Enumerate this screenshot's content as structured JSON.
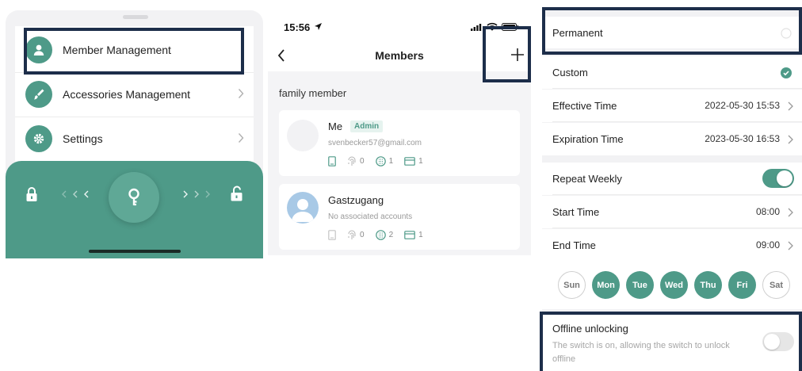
{
  "panel1": {
    "menu": [
      {
        "label": "Member Management",
        "icon": "person-icon"
      },
      {
        "label": "Accessories Management",
        "icon": "brush-icon"
      },
      {
        "label": "Settings",
        "icon": "gear-icon"
      }
    ],
    "controls": {
      "lock_icon": "lock-icon",
      "unlock_icon": "unlock-icon",
      "key_icon": "key-icon"
    },
    "colors": {
      "accent": "#4e9a88",
      "highlight": "#1d2e4a"
    }
  },
  "panel2": {
    "status_time": "15:56",
    "nav_title": "Members",
    "section": "family member",
    "members": [
      {
        "name": "Me",
        "badge": "Admin",
        "subtitle": "svenbecker57@gmail.com",
        "fingerprints": "0",
        "passwords": "1",
        "cards": "1"
      },
      {
        "name": "Gastzugang",
        "badge": "",
        "subtitle": "No associated accounts",
        "fingerprints": "0",
        "passwords": "2",
        "cards": "1"
      }
    ]
  },
  "panel3": {
    "permanent": "Permanent",
    "custom": "Custom",
    "effective_label": "Effective Time",
    "effective_value": "2022-05-30 15:53",
    "expiration_label": "Expiration Time",
    "expiration_value": "2023-05-30 16:53",
    "repeat_label": "Repeat Weekly",
    "repeat_on": true,
    "start_label": "Start Time",
    "start_value": "08:00",
    "end_label": "End Time",
    "end_value": "09:00",
    "days": [
      {
        "label": "Sun",
        "on": false
      },
      {
        "label": "Mon",
        "on": true
      },
      {
        "label": "Tue",
        "on": true
      },
      {
        "label": "Wed",
        "on": true
      },
      {
        "label": "Thu",
        "on": true
      },
      {
        "label": "Fri",
        "on": true
      },
      {
        "label": "Sat",
        "on": false
      }
    ],
    "offline_title": "Offline unlocking",
    "offline_desc": "The switch is on, allowing the switch to unlock offline",
    "offline_on": false
  }
}
